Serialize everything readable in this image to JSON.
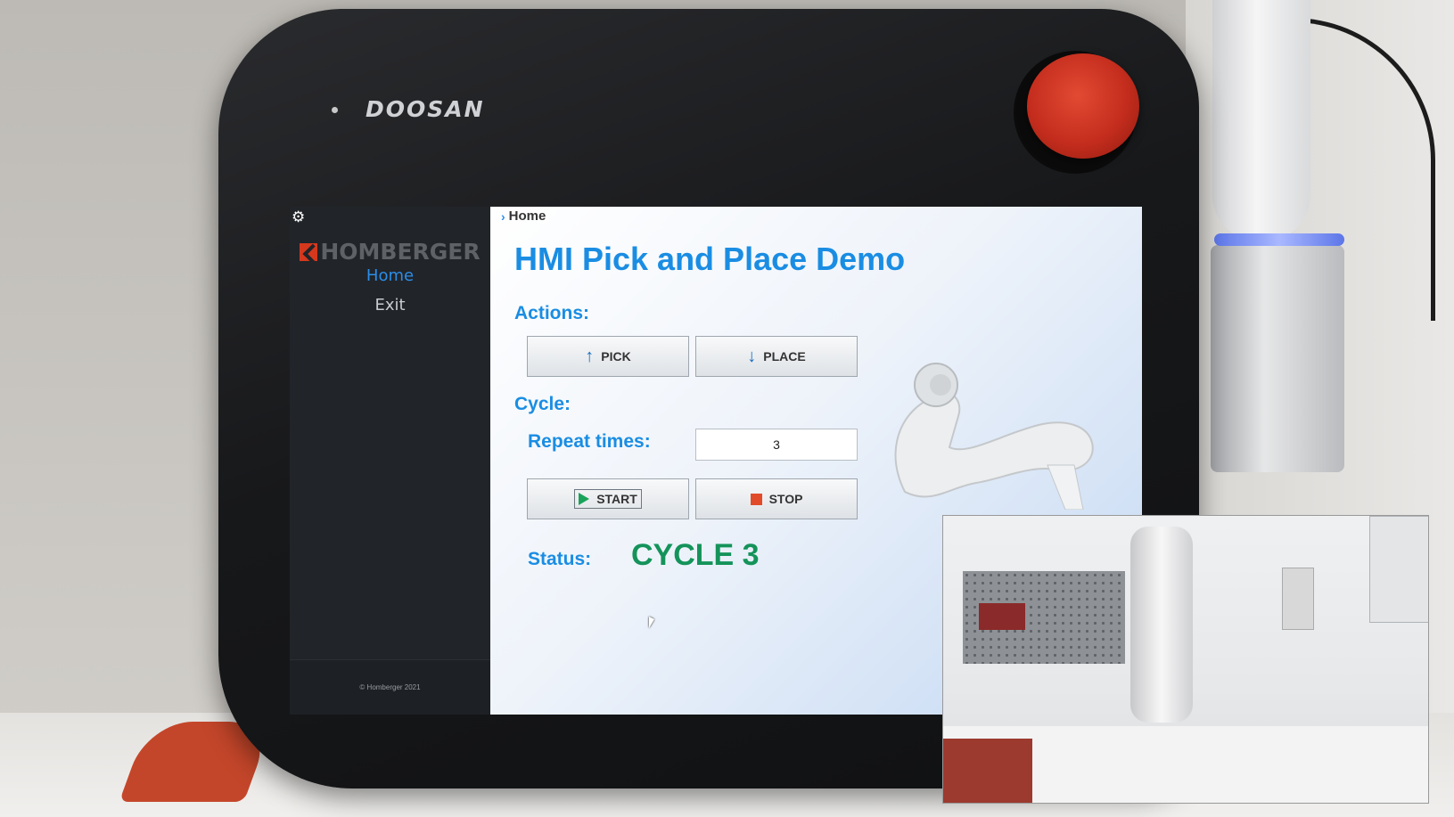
{
  "device": {
    "brand": "DOOSAN"
  },
  "sidebar": {
    "logo_text": "HOMBERGER",
    "items": [
      {
        "label": "Home",
        "active": true
      },
      {
        "label": "Exit",
        "active": false
      }
    ],
    "footer": "© Homberger 2021"
  },
  "breadcrumb": {
    "label": "Home"
  },
  "main": {
    "title": "HMI Pick and Place Demo",
    "actions_label": "Actions:",
    "pick_label": "PICK",
    "place_label": "PLACE",
    "cycle_label": "Cycle:",
    "repeat_label": "Repeat times:",
    "repeat_value": "3",
    "start_label": "START",
    "stop_label": "STOP",
    "status_label": "Status:",
    "status_value": "CYCLE 3"
  },
  "icons": {
    "settings": "gear-icon",
    "pick": "arrow-up-icon",
    "place": "arrow-down-icon",
    "start": "play-icon",
    "stop": "stop-square-icon"
  },
  "colors": {
    "accent": "#1a8de3",
    "status_ok": "#14935a",
    "sidebar_bg": "#212429",
    "logo_red": "#d6381e",
    "stop_red": "#e24b2a",
    "play_green": "#19a35a"
  }
}
